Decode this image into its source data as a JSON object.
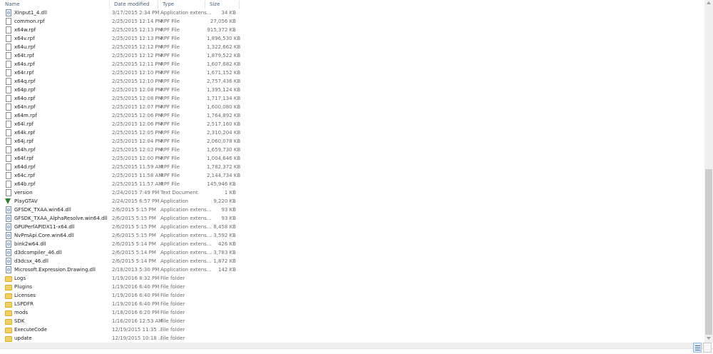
{
  "columns": {
    "name": "Name",
    "date": "Date modified",
    "type": "Type",
    "size": "Size"
  },
  "files": [
    {
      "icon": "dll-file-icon",
      "name": "XInput1_4.dll",
      "date": "3/17/2015 2:34 PM",
      "type": "Application extens...",
      "size": "34 KB"
    },
    {
      "icon": "file-icon",
      "name": "common.rpf",
      "date": "2/25/2015 12:14 PM",
      "type": "RPF File",
      "size": "27,056 KB"
    },
    {
      "icon": "file-icon",
      "name": "x64w.rpf",
      "date": "2/25/2015 12:13 PM",
      "type": "RPF File",
      "size": "915,372 KB"
    },
    {
      "icon": "file-icon",
      "name": "x64v.rpf",
      "date": "2/25/2015 12:13 PM",
      "type": "RPF File",
      "size": "1,896,530 KB"
    },
    {
      "icon": "file-icon",
      "name": "x64u.rpf",
      "date": "2/25/2015 12:12 PM",
      "type": "RPF File",
      "size": "1,322,662 KB"
    },
    {
      "icon": "file-icon",
      "name": "x64t.rpf",
      "date": "2/25/2015 12:12 PM",
      "type": "RPF File",
      "size": "1,879,522 KB"
    },
    {
      "icon": "file-icon",
      "name": "x64s.rpf",
      "date": "2/25/2015 12:11 PM",
      "type": "RPF File",
      "size": "1,607,682 KB"
    },
    {
      "icon": "file-icon",
      "name": "x64r.rpf",
      "date": "2/25/2015 12:10 PM",
      "type": "RPF File",
      "size": "1,671,152 KB"
    },
    {
      "icon": "file-icon",
      "name": "x64q.rpf",
      "date": "2/25/2015 12:10 PM",
      "type": "RPF File",
      "size": "2,757,436 KB"
    },
    {
      "icon": "file-icon",
      "name": "x64p.rpf",
      "date": "2/25/2015 12:08 PM",
      "type": "RPF File",
      "size": "1,395,124 KB"
    },
    {
      "icon": "file-icon",
      "name": "x64o.rpf",
      "date": "2/25/2015 12:08 PM",
      "type": "RPF File",
      "size": "1,717,134 KB"
    },
    {
      "icon": "file-icon",
      "name": "x64n.rpf",
      "date": "2/25/2015 12:07 PM",
      "type": "RPF File",
      "size": "1,600,080 KB"
    },
    {
      "icon": "file-icon",
      "name": "x64m.rpf",
      "date": "2/25/2015 12:06 PM",
      "type": "RPF File",
      "size": "1,764,892 KB"
    },
    {
      "icon": "file-icon",
      "name": "x64l.rpf",
      "date": "2/25/2015 12:06 PM",
      "type": "RPF File",
      "size": "2,517,160 KB"
    },
    {
      "icon": "file-icon",
      "name": "x64k.rpf",
      "date": "2/25/2015 12:05 PM",
      "type": "RPF File",
      "size": "2,310,204 KB"
    },
    {
      "icon": "file-icon",
      "name": "x64j.rpf",
      "date": "2/25/2015 12:04 PM",
      "type": "RPF File",
      "size": "2,060,078 KB"
    },
    {
      "icon": "file-icon",
      "name": "x64h.rpf",
      "date": "2/25/2015 12:02 PM",
      "type": "RPF File",
      "size": "1,659,730 KB"
    },
    {
      "icon": "file-icon",
      "name": "x64f.rpf",
      "date": "2/25/2015 12:00 PM",
      "type": "RPF File",
      "size": "1,004,646 KB"
    },
    {
      "icon": "file-icon",
      "name": "x64d.rpf",
      "date": "2/25/2015 11:59 AM",
      "type": "RPF File",
      "size": "1,782,372 KB"
    },
    {
      "icon": "file-icon",
      "name": "x64c.rpf",
      "date": "2/25/2015 11:58 AM",
      "type": "RPF File",
      "size": "2,144,734 KB"
    },
    {
      "icon": "file-icon",
      "name": "x64b.rpf",
      "date": "2/25/2015 11:57 AM",
      "type": "RPF File",
      "size": "145,946 KB"
    },
    {
      "icon": "file-icon",
      "name": "version",
      "date": "2/24/2015 7:49 PM",
      "type": "Text Document",
      "size": "1 KB"
    },
    {
      "icon": "app-icon",
      "name": "PlayGTAV",
      "date": "2/24/2015 6:57 PM",
      "type": "Application",
      "size": "9,220 KB"
    },
    {
      "icon": "dll-file-icon",
      "name": "GFSDK_TXAA.win64.dll",
      "date": "2/6/2015 5:15 PM",
      "type": "Application extens...",
      "size": "93 KB"
    },
    {
      "icon": "dll-file-icon",
      "name": "GFSDK_TXAA_AlphaResolve.win64.dll",
      "date": "2/6/2015 5:15 PM",
      "type": "Application extens...",
      "size": "93 KB"
    },
    {
      "icon": "dll-file-icon",
      "name": "GPUPerfAPIDX11-x64.dll",
      "date": "2/6/2015 5:15 PM",
      "type": "Application extens...",
      "size": "8,458 KB"
    },
    {
      "icon": "dll-file-icon",
      "name": "NvPmApi.Core.win64.dll",
      "date": "2/6/2015 5:15 PM",
      "type": "Application extens...",
      "size": "3,592 KB"
    },
    {
      "icon": "dll-file-icon",
      "name": "bink2w64.dll",
      "date": "2/6/2015 5:14 PM",
      "type": "Application extens...",
      "size": "426 KB"
    },
    {
      "icon": "dll-file-icon",
      "name": "d3dcompiler_46.dll",
      "date": "2/6/2015 5:14 PM",
      "type": "Application extens...",
      "size": "3,783 KB"
    },
    {
      "icon": "dll-file-icon",
      "name": "d3dcsx_46.dll",
      "date": "2/6/2015 5:14 PM",
      "type": "Application extens...",
      "size": "1,872 KB"
    },
    {
      "icon": "dll-file-icon",
      "name": "Microsoft.Expression.Drawing.dll",
      "date": "2/18/2013 5:30 PM",
      "type": "Application extens...",
      "size": "142 KB"
    },
    {
      "icon": "folder-icon",
      "name": "Logs",
      "date": "1/19/2016 8:32 PM",
      "type": "File folder",
      "size": ""
    },
    {
      "icon": "folder-icon",
      "name": "Plugins",
      "date": "1/19/2016 6:40 PM",
      "type": "File folder",
      "size": ""
    },
    {
      "icon": "folder-icon",
      "name": "Licenses",
      "date": "1/19/2016 6:40 PM",
      "type": "File folder",
      "size": ""
    },
    {
      "icon": "folder-icon",
      "name": "LSPDFR",
      "date": "1/19/2016 6:40 PM",
      "type": "File folder",
      "size": ""
    },
    {
      "icon": "folder-icon",
      "name": "mods",
      "date": "1/18/2016 6:20 PM",
      "type": "File folder",
      "size": ""
    },
    {
      "icon": "folder-icon",
      "name": "SDK",
      "date": "1/16/2016 12:53 AM",
      "type": "File folder",
      "size": ""
    },
    {
      "icon": "folder-icon",
      "name": "ExecuteCode",
      "date": "12/19/2015 11:35 ...",
      "type": "File folder",
      "size": ""
    },
    {
      "icon": "folder-icon",
      "name": "update",
      "date": "12/19/2015 10:18 ...",
      "type": "File folder",
      "size": ""
    }
  ],
  "scrollbar": {
    "position_fraction": 1.0
  }
}
